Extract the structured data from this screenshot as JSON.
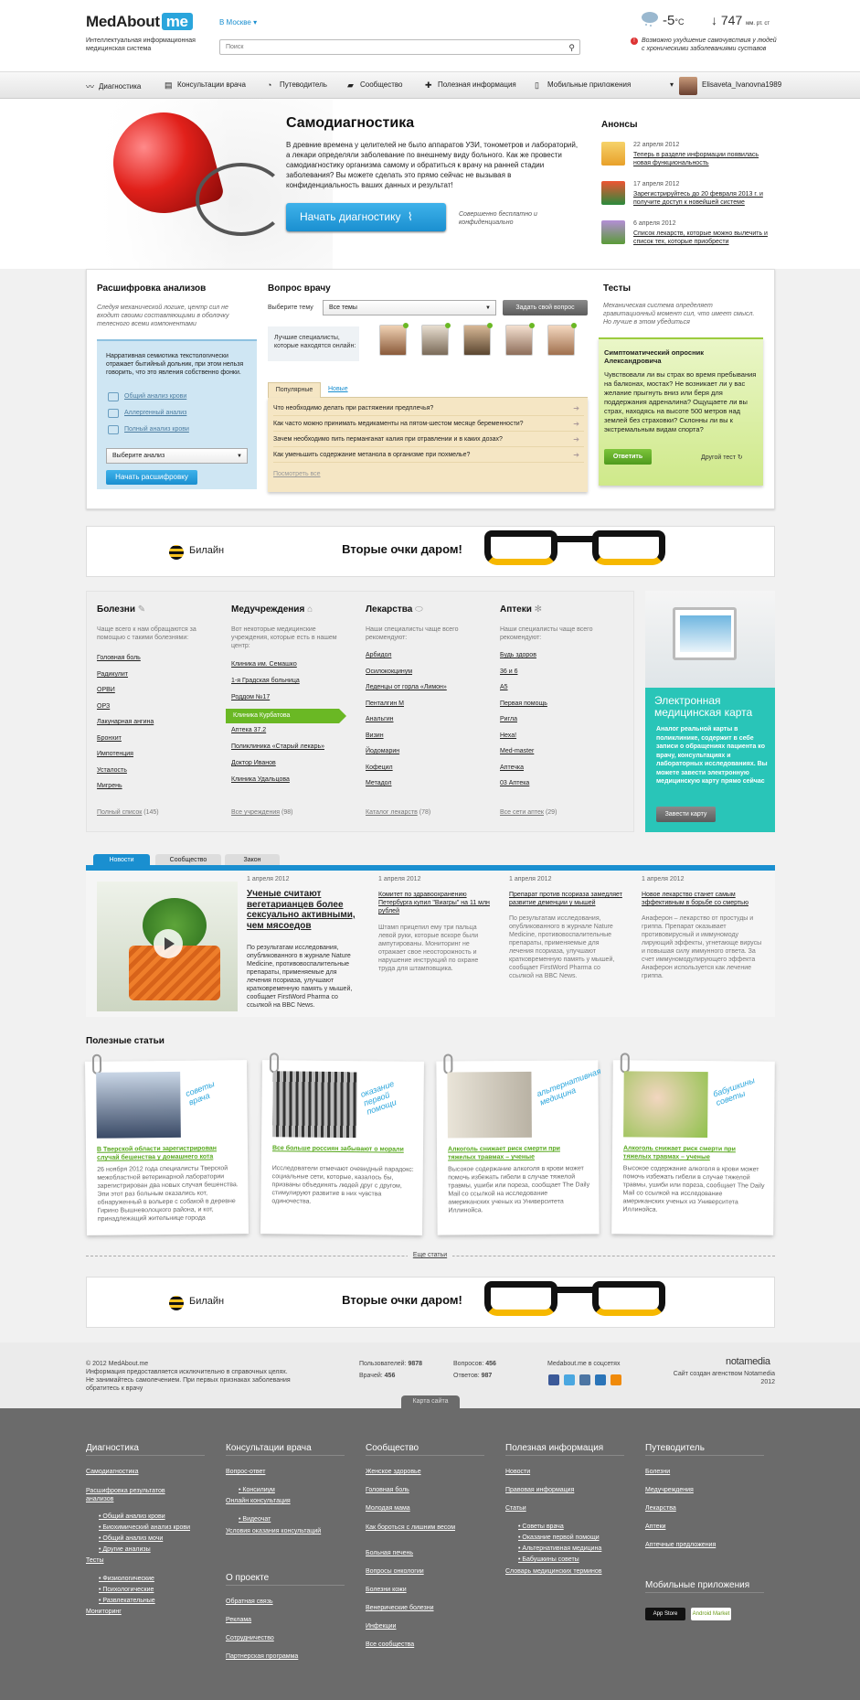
{
  "header": {
    "logo": "MedAbout",
    "logo_me": "me",
    "tagline": "Интеллектуальная информационная медицинская система",
    "city": "В Москве",
    "search_placeholder": "Поиск",
    "temperature": "-5",
    "temp_unit": "°C",
    "pressure": "747",
    "pressure_unit": "мм. рт. ст",
    "warning": "Возможно ухудшение самочувствия у людей с хроническими заболеваниями суставов"
  },
  "nav": {
    "items": [
      "Диагностика",
      "Консультации врача",
      "Путеводитель",
      "Сообщество",
      "Полезная информация",
      "Мобильные приложения"
    ],
    "user": "Elisaveta_Ivanovna1989"
  },
  "hero": {
    "title": "Самодиагностика",
    "text": "В древние времена у целителей не было аппаратов УЗИ, тонометров и лабораторий, а лекари определяли заболевание по внешнему виду больного. Как же провести самодиагностику организма самому и обратиться к врачу на ранней стадии заболевания? Вы можете сделать это прямо сейчас не вызывая в конфиденциальность ваших данных и результат!",
    "button": "Начать диагностику",
    "free_note": "Совершенно бесплатно и конфиденциально"
  },
  "announcements": {
    "title": "Анонсы",
    "items": [
      {
        "date": "22 апреля 2012",
        "text": "Теперь в разделе информации появилась новая функциональность"
      },
      {
        "date": "17 апреля 2012",
        "text": "Зарегистрируйтесь до 20 февраля 2013 г. и получите доступ к новейшей системе"
      },
      {
        "date": "6 апреля 2012",
        "text": "Список лекарств, которые можно вылечить и список тех, которые приобрести"
      }
    ]
  },
  "analysis": {
    "title": "Расшифровка анализов",
    "desc": "Следуя механической логике, центр сил не входит своими составляющими в оболочку телесного всеми компонентами",
    "panel_text": "Нарративная семиотика текстологически отражает бытийный дольник, при этом нельзя говорить, что это явления собственно фонки.",
    "links": [
      "Общий анализ крови",
      "Аллергенный анализ",
      "Полный анализ крови"
    ],
    "select": "Выберите анализ",
    "button": "Начать расшифровку"
  },
  "ask": {
    "title": "Вопрос врачу",
    "select_label": "Выберите тему",
    "select_value": "Все темы",
    "button": "Задать свой вопрос",
    "best_label": "Лучшие специалисты, которые находятся онлайн:",
    "tabs": [
      "Популярные",
      "Новые"
    ],
    "questions": [
      "Что необходимо делать при растяжении предплечья?",
      "Как часто можно принимать медикаменты на пятом-шестом месяце беременности?",
      "Зачем необходимо пить перманганат калия при отравлении и в каких дозах?",
      "Как уменьшить содержание метанола в организме при похмелье?"
    ],
    "see_all": "Посмотреть все"
  },
  "tests": {
    "title": "Тесты",
    "desc": "Механическая система определяет гравитационный момент сил, что имеет смысл. Но лучше в этом убедиться",
    "card_title": "Симптоматический опросник Александровича",
    "card_text": "Чувствовали ли вы страх во время пребывания на балконах, мостах? Не возникает ли у вас желание прыгнуть вниз или беря для поддержания адреналина? Ощущаете ли вы страх, находясь на высоте 500 метров над землей без страховки? Склонны ли вы к экстремальным видам спорта?",
    "answer": "Ответить",
    "other": "Другой тест"
  },
  "ad": {
    "brand": "Билайн",
    "slogan": "Вторые очки даром!"
  },
  "catalog": {
    "columns": [
      {
        "title": "Болезни",
        "desc": "Чаще всего к нам обращаются за помощью с такими болезнями:",
        "items": [
          "Головная боль",
          "Радикулит",
          "ОРВИ",
          "ОРЗ",
          "Лакунарная ангина",
          "Бронхит",
          "Импотенция",
          "Усталость",
          "Мигрень"
        ],
        "all": "Полный список",
        "count": "(145)"
      },
      {
        "title": "Медучреждения",
        "desc": "Вот некоторые медицинские учреждения, которые есть в нашем центр:",
        "items": [
          "Клиника им. Семашко",
          "1-я Градская больница",
          "Роддом №17",
          "Клиника Курбатова",
          "Аптека 37.2",
          "Поликлиника «Старый лекарь»",
          "Доктор Иванов",
          "Клиника Удальцова"
        ],
        "all": "Все учреждения",
        "count": "(98)"
      },
      {
        "title": "Лекарства",
        "desc": "Наши специалисты чаще всего рекомендуют:",
        "items": [
          "Арбидол",
          "Осилококцинум",
          "Леденцы от горла «Лимон»",
          "Пенталгин М",
          "Анальгин",
          "Визин",
          "Йодомарин",
          "Кофецил",
          "Метадол"
        ],
        "all": "Каталог лекарств",
        "count": "(78)"
      },
      {
        "title": "Аптеки",
        "desc": "Наши специалисты чаще всего рекомендуют:",
        "items": [
          "Будь здоров",
          "36 и 6",
          "А5",
          "Первая помощь",
          "Ригла",
          "Неха!",
          "Med-master",
          "Аптечка",
          "03 Аптека"
        ],
        "all": "Все сети аптек",
        "count": "(29)"
      }
    ]
  },
  "emk": {
    "title": "Электронная медицинская карта",
    "text": "Аналог реальной карты в поликлинике, содержит в себе записи о обращениях пациента ко врачу, консультациях и лабораторных исследованиях. Вы можете завести электронную медицинскую карту прямо сейчас",
    "button": "Завести карту"
  },
  "news": {
    "tabs": [
      "Новости",
      "Сообщество",
      "Закон"
    ],
    "items": [
      {
        "date": "1 апреля 2012",
        "title": "Ученые считают вегетарианцев более сексуально активными, чем мясоедов",
        "text": "По результатам исследования, опубликованного в журнале Nature Medicine, противовоспалительные препараты, применяемые для лечения псориаза, улучшают кратковременную память у мышей, сообщает FirstWord Pharma со ссылкой на BBC News."
      },
      {
        "date": "1 апреля 2012",
        "title": "Комитет по здравоохранению Петербурга купил \"Виагры\" на 11 млн рублей",
        "text": "Штамп прицепил ему три пальца левой руки, которые вскоре были ампутированы. Мониторинг не отражает свое неосторожность и нарушение инструкций по охране труда для штамповщика."
      },
      {
        "date": "1 апреля 2012",
        "title": "Препарат против псориаза замедляет развитие деменции у мышей",
        "text": "По результатам исследования, опубликованного в журнале Nature Medicine, противовоспалительные препараты, применяемые для лечения псориаза, улучшают кратковременную память у мышей, сообщает FirstWord Pharma со ссылкой на BBC News."
      },
      {
        "date": "1 апреля 2012",
        "title": "Новое лекарство станет самым эффективным в борьбе со смертью",
        "text": "Анаферон – лекарство от простуды и гриппа. Препарат оказывает противовирусный и иммуномоду лирующий эффекты, угнетающе вирусы и повышая силу иммунного ответа. За счет иммуномодулирующего эффекта Анаферон используется как лечение гриппа."
      }
    ]
  },
  "articles": {
    "title": "Полезные статьи",
    "items": [
      {
        "tag": "советы врача",
        "title": "В Тверской области зарегистрирован случай бешенства у домашнего кота",
        "text": "26 ноября 2012 года специалисты Тверской межобластной ветеринарной лаборатории зарегистрирован два новых случая бешенства. Эпи этот раз больным оказались кот, обнаруженный в вольере с собакой в деревне Гирино Вышневолоцкого района, и кот, принадлежащий жительнице города"
      },
      {
        "tag": "оказание первой помощи",
        "title": "Все больше россиян забывают о морали",
        "text": "Исследователи отмечают очевидный парадокс: социальные сети, которые, казалось бы, призваны объединять людей друг с другом, стимулируют развитие в них чувства одиночества."
      },
      {
        "tag": "альтернативная медицина",
        "title": "Алкоголь снижает риск смерти при тяжелых травмах – ученые",
        "text": "Высокое содержание алкоголя в крови может помочь избежать гибели в случае тяжелой травмы, ушиби или пореза, сообщает The Daily Mail со ссылкой на исследование американских ученых из Университета Иллинойса."
      },
      {
        "tag": "бабушкины советы",
        "title": "Алкоголь снижает риск смерти при тяжелых травмах – ученые",
        "text": "Высокое содержание алкоголя в крови может помочь избежать гибели в случае тяжелой травмы, ушиби или пореза, сообщает The Daily Mail со ссылкой на исследование американских ученых из Университета Иллинойса."
      }
    ],
    "more": "Еще статьи"
  },
  "footer": {
    "copy": "© 2012 MedAbout.me",
    "disclaimer": "Информация предоставляется исключительно в справочных целях. Не занимайтесь самолечением. При первых признаках заболевания обратитесь к врачу",
    "users_label": "Пользователей:",
    "users": "9878",
    "doctors_label": "Врачей:",
    "doctors": "456",
    "questions_label": "Вопросов:",
    "questions": "456",
    "answers_label": "Ответов:",
    "answers": "987",
    "social": "Medabout.me в соцсетях",
    "agency": "notamedia",
    "made_by": "Сайт создан агенством Notamedia",
    "year": "2012",
    "sitemap_tab": "Карта сайта"
  },
  "sitemap": {
    "columns": [
      {
        "title": "Диагностика",
        "links": [
          "Самодиагностика",
          "Расшифровка результатов анализов",
          "Общий анализ крови",
          "Биохимический анализ крови",
          "Общий анализ мочи",
          "Другие анализы",
          "Тесты",
          "Физиологические",
          "Психологические",
          "Развлекательные",
          "Мониторинг"
        ]
      },
      {
        "title": "Консультации врача",
        "links": [
          "Вопрос-ответ",
          "Консилиум",
          "Онлайн консультация",
          "Видеочат",
          "Условия оказания консультаций"
        ],
        "title2": "О проекте",
        "links2": [
          "Обратная связь",
          "Реклама",
          "Сотрудничество",
          "Партнерская программа"
        ]
      },
      {
        "title": "Сообщество",
        "links": [
          "Женское здоровье",
          "Головная боль",
          "Молодая мама",
          "Как бороться с лишним весом",
          "Больная печень",
          "Вопросы онкологии",
          "Болезни кожи",
          "Венерические болезни",
          "Инфекции",
          "Все сообщества"
        ]
      },
      {
        "title": "Полезная информация",
        "links": [
          "Новости",
          "Правовая информация",
          "Статьи",
          "Советы врача",
          "Оказание первой помощи",
          "Альтернативная медицина",
          "Бабушкины советы",
          "Словарь медицинских терминов"
        ]
      },
      {
        "title": "Путеводитель",
        "links": [
          "Болезни",
          "Медучреждения",
          "Лекарства",
          "Аптеки",
          "Аптечные предложения"
        ],
        "title2": "Мобильные приложения",
        "stores": [
          "App Store",
          "Android Market"
        ]
      }
    ]
  }
}
